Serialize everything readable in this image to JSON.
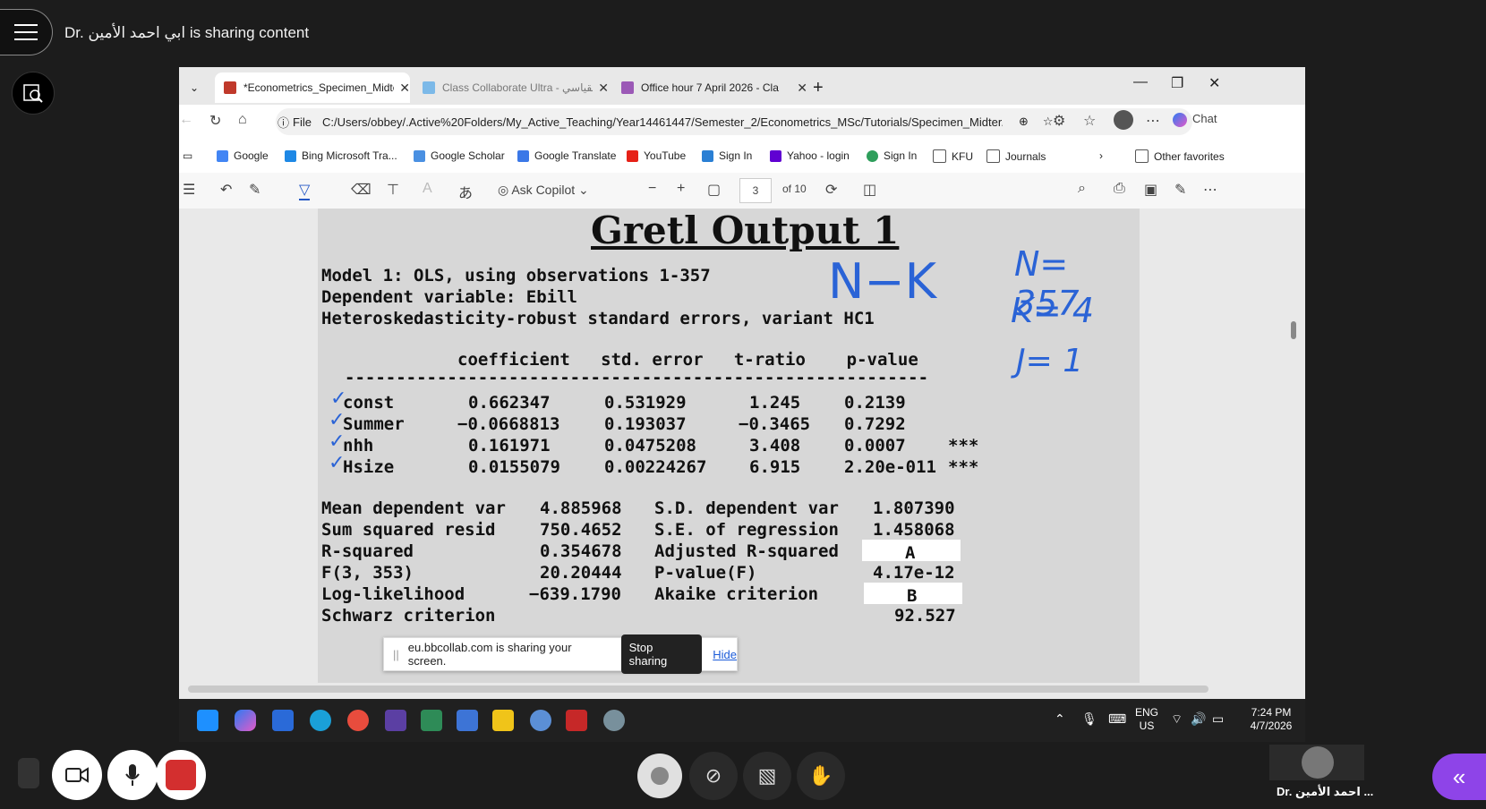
{
  "collab": {
    "sharing_label": "Dr. ابي احمد الأمين is sharing content",
    "presenter_name": "Dr. احمد الأمين ..."
  },
  "browser": {
    "tabs": [
      {
        "title": "*Econometrics_Specimen_Midterm",
        "active": true
      },
      {
        "title": "Class Collaborate Ultra - القياسي",
        "active": false
      },
      {
        "title": "Office hour 7 April 2026 - Cla",
        "active": false
      }
    ],
    "address": {
      "scheme_label": "File",
      "url": "C:/Users/obbey/.Active%20Folders/My_Active_Teaching/Year14461447/Semester_2/Econometrics_MSc/Tutorials/Specimen_Midter..."
    },
    "chat_label": "Chat",
    "favorites": [
      "Google",
      "Bing Microsoft Tra...",
      "Google Scholar",
      "Google Translate",
      "YouTube",
      "Sign In",
      "Yahoo - login",
      "Sign In",
      "KFU",
      "Journals"
    ],
    "other_favorites": "Other favorites"
  },
  "pdf_toolbar": {
    "ask_copilot": "Ask Copilot",
    "page_current": "3",
    "page_total": "of 10"
  },
  "document": {
    "title": "Gretl Output 1",
    "model_line": "Model 1: OLS, using observations 1-357",
    "dependent_line": "Dependent variable: Ebill",
    "hetero_line": "Heteroskedasticity-robust standard errors, variant HC1",
    "table_header": "coefficient   std. error   t-ratio    p-value",
    "table_rule": "---------------------------------------------------------",
    "rows": [
      {
        "name": "const",
        "coef": "0.662347",
        "se": "0.531929",
        "t": "1.245",
        "p": "0.2139",
        "stars": ""
      },
      {
        "name": "Summer",
        "coef": "−0.0668813",
        "se": "0.193037",
        "t": "−0.3465",
        "p": "0.7292",
        "stars": ""
      },
      {
        "name": "nhh",
        "coef": "0.161971",
        "se": "0.0475208",
        "t": "3.408",
        "p": "0.0007",
        "stars": "***"
      },
      {
        "name": "Hsize",
        "coef": "0.0155079",
        "se": "0.00224267",
        "t": "6.915",
        "p": "2.20e-011",
        "stars": "***"
      }
    ],
    "stats": [
      {
        "l1": "Mean dependent var",
        "v1": "4.885968",
        "l2": "S.D. dependent var",
        "v2": "1.807390"
      },
      {
        "l1": "Sum squared resid",
        "v1": "750.4652",
        "l2": "S.E. of regression",
        "v2": "1.458068"
      },
      {
        "l1": "R-squared",
        "v1": "0.354678",
        "l2": "Adjusted R-squared",
        "v2": "A"
      },
      {
        "l1": "F(3, 353)",
        "v1": "20.20444",
        "l2": "P-value(F)",
        "v2": "4.17e-12"
      },
      {
        "l1": "Log-likelihood",
        "v1": "−639.1790",
        "l2": "Akaike criterion",
        "v2": "B"
      },
      {
        "l1": "Schwarz criterion",
        "v1": "",
        "l2": "",
        "v2": "92.527"
      }
    ],
    "handwriting": {
      "nk": "N−K",
      "n": "N= 357",
      "k": "K= 4",
      "j": "J= 1"
    }
  },
  "share_notice": {
    "text": "eu.bbcollab.com is sharing your screen.",
    "stop": "Stop sharing",
    "hide": "Hide"
  },
  "taskbar": {
    "lang1": "ENG",
    "lang2": "US",
    "time": "7:24 PM",
    "date": "4/7/2026"
  }
}
